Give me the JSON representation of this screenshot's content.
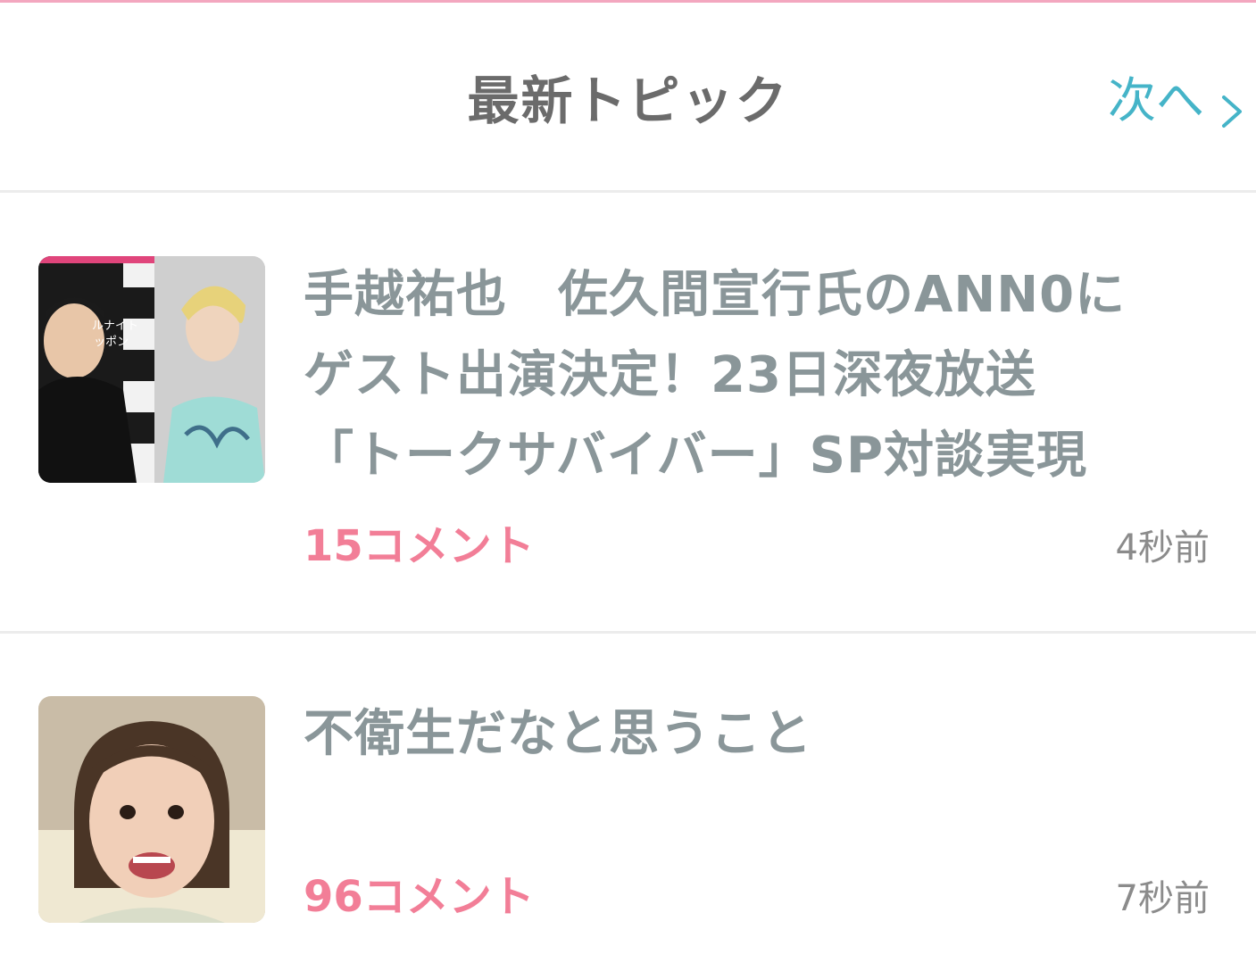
{
  "header": {
    "title": "最新トピック",
    "next_label": "次へ"
  },
  "topics": [
    {
      "title_lines": [
        "手越祐也　佐久間宣行氏のANN0に",
        "ゲスト出演決定！23日深夜放送",
        "「トークサバイバー」SP対談実現"
      ],
      "comments": "15コメント",
      "time": "4秒前",
      "thumb_text_lines": [
        "ルナイト",
        "ッポン"
      ]
    },
    {
      "title_lines": [
        "不衛生だなと思うこと"
      ],
      "comments": "96コメント",
      "time": "7秒前"
    }
  ],
  "colors": {
    "accent_pink": "#f27e97",
    "link_teal": "#45b4c8",
    "title_gray": "#8a9699",
    "header_gray": "#6b6b6b"
  }
}
